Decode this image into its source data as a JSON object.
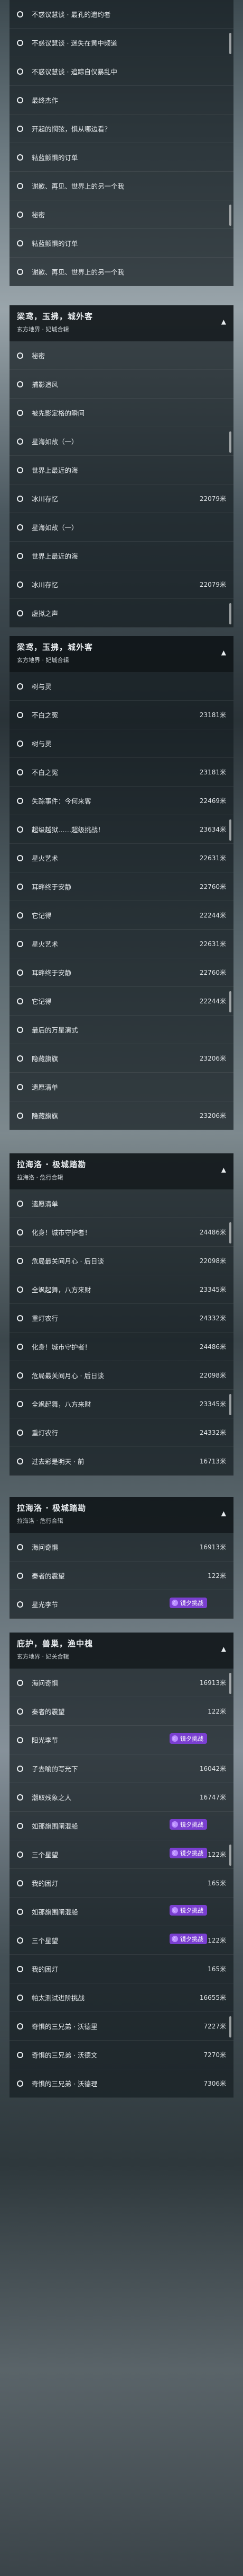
{
  "headers": [
    {
      "title": "梁鸢，玉拂，城外客",
      "subtitle": "玄方地界 · 妃城合辑"
    },
    {
      "title": "梁鸢，玉拂，城外客",
      "subtitle": "玄方地界 · 妃城合辑"
    },
    {
      "title": "拉海洛 · 极城踏勘",
      "subtitle": "拉海洛 · 危行合辑"
    },
    {
      "title": "拉海洛 · 极城踏勘",
      "subtitle": "拉海洛 · 危行合辑"
    },
    {
      "title": "庇护，兽巢，渔中槐",
      "subtitle": "玄方地界 · 妃关合辑"
    }
  ],
  "badge_label": "镜夕挑战",
  "rows": [
    {
      "label": "不惑议慧谈 · 最孔的遗约者",
      "meta": ""
    },
    {
      "label": "不惑议慧谈 · 迷失在黄中频道",
      "meta": ""
    },
    {
      "label": "不惑议慧谈 · 追踪自仪暴乱中",
      "meta": ""
    },
    {
      "label": "最终杰作",
      "meta": ""
    },
    {
      "label": "开起的惘弦，惧从哪边看？",
      "meta": ""
    },
    {
      "label": "轱蓝颤惧的订单",
      "meta": ""
    },
    {
      "label": "谢歉、再见、世界上的另一个我",
      "meta": ""
    },
    {
      "label": "秘密",
      "meta": ""
    },
    {
      "label": "轱蓝颤惧的订单",
      "meta": ""
    },
    {
      "label": "谢歉、再见、世界上的另一个我",
      "meta": ""
    },
    {
      "label": "秘密",
      "meta": ""
    },
    {
      "label": "捕影追风",
      "meta": ""
    },
    {
      "label": "被先影定格的瞬间",
      "meta": ""
    },
    {
      "label": "星海如故（一）",
      "meta": ""
    },
    {
      "label": "世界上最近的海",
      "meta": ""
    },
    {
      "label": "冰川存忆",
      "meta": "22079米"
    },
    {
      "label": "星海如故（一）",
      "meta": ""
    },
    {
      "label": "世界上最近的海",
      "meta": ""
    },
    {
      "label": "冰川存忆",
      "meta": "22079米"
    },
    {
      "label": "虚拟之声",
      "meta": ""
    },
    {
      "label": "树与灵",
      "meta": ""
    },
    {
      "label": "不白之冤",
      "meta": "23181米"
    },
    {
      "label": "树与灵",
      "meta": ""
    },
    {
      "label": "不白之冤",
      "meta": "23181米"
    },
    {
      "label": "失踪事件：今何来客",
      "meta": "22469米"
    },
    {
      "label": "超级越狱……超级挑战！",
      "meta": "23634米"
    },
    {
      "label": "星火艺术",
      "meta": "22631米"
    },
    {
      "label": "耳畔终于安静",
      "meta": "22760米"
    },
    {
      "label": "它记得",
      "meta": "22244米"
    },
    {
      "label": "星火艺术",
      "meta": "22631米"
    },
    {
      "label": "耳畔终于安静",
      "meta": "22760米"
    },
    {
      "label": "它记得",
      "meta": "22244米"
    },
    {
      "label": "最后的万星演式",
      "meta": ""
    },
    {
      "label": "隐藏旗旗",
      "meta": "23206米"
    },
    {
      "label": "遗愿清单",
      "meta": ""
    },
    {
      "label": "隐藏旗旗",
      "meta": "23206米"
    },
    {
      "label": "遗愿清单",
      "meta": ""
    },
    {
      "label": "化身！城市守护者！",
      "meta": "24486米"
    },
    {
      "label": "危局最关间月心 · 后日谈",
      "meta": "22098米"
    },
    {
      "label": "全飒起舞，八方来财",
      "meta": "23345米"
    },
    {
      "label": "重灯农行",
      "meta": "24332米"
    },
    {
      "label": "化身！城市守护者！",
      "meta": "24486米"
    },
    {
      "label": "危局最关间月心 · 后日谈",
      "meta": "22098米"
    },
    {
      "label": "全飒起舞，八方来财",
      "meta": "23345米"
    },
    {
      "label": "重灯农行",
      "meta": "24332米"
    },
    {
      "label": "过去彩是明天 · 前",
      "meta": "16713米"
    },
    {
      "label": "海问奇惧",
      "meta": "16913米"
    },
    {
      "label": "秦者的震望",
      "meta": "122米"
    },
    {
      "label": "星光李节",
      "meta": "",
      "badge": true
    },
    {
      "label": "海问奇惧",
      "meta": "16913米"
    },
    {
      "label": "秦者的震望",
      "meta": "122米"
    },
    {
      "label": "阳光李节",
      "meta": "",
      "badge": true
    },
    {
      "label": "子去喻的写光下",
      "meta": "16042米"
    },
    {
      "label": "潮取残象之人",
      "meta": "16747米"
    },
    {
      "label": "如那旗围闸混船",
      "meta": "",
      "badge": true
    },
    {
      "label": "三个星望",
      "meta": "122米",
      "badge": true
    },
    {
      "label": "我的困灯",
      "meta": "165米"
    },
    {
      "label": "如那旗围闸混船",
      "meta": "",
      "badge": true
    },
    {
      "label": "三个星望",
      "meta": "122米",
      "badge": true
    },
    {
      "label": "我的困灯",
      "meta": "165米"
    },
    {
      "label": "帕太测试进阶挑战",
      "meta": "16655米"
    },
    {
      "label": "奇惧的三兄弟 · 沃德里",
      "meta": "7227米"
    },
    {
      "label": "奇惧的三兄弟 · 沃德文",
      "meta": "7270米"
    },
    {
      "label": "奇惧的三兄弟 · 沃德理",
      "meta": "7306米"
    }
  ]
}
